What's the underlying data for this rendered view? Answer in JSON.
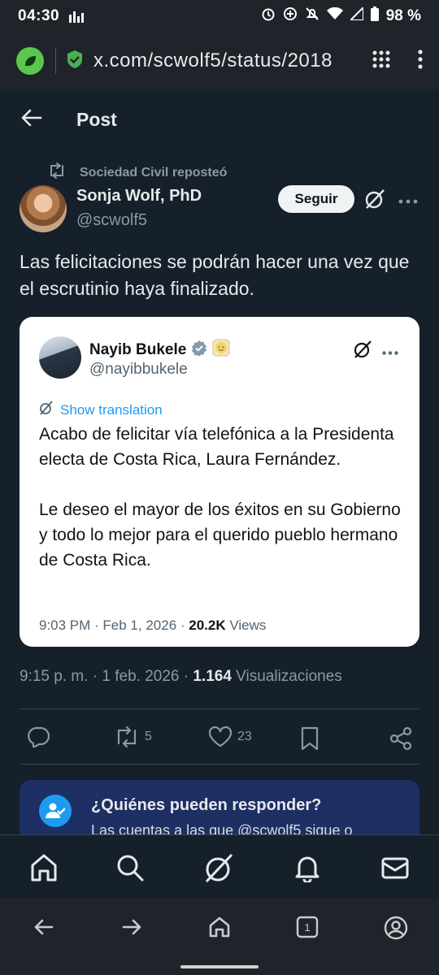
{
  "status_bar": {
    "time": "04:30",
    "battery": "98 %"
  },
  "browser": {
    "url": "x.com/scwolf5/status/2018"
  },
  "header": {
    "title": "Post"
  },
  "post": {
    "repost_label": "Sociedad Civil reposteó",
    "author_name": "Sonja Wolf, PhD",
    "author_handle": "@scwolf5",
    "follow_label": "Seguir",
    "text": "Las felicitaciones se podrán hacer una vez que el escrutinio haya finalizado.",
    "time": "9:15 p. m. · 1 feb. 2026 · ",
    "views_count": "1.164",
    "views_label": " Visualizaciones",
    "reposts": "5",
    "likes": "23"
  },
  "quote": {
    "author_name": "Nayib Bukele",
    "author_handle": "@nayibbukele",
    "translate_label": "Show translation",
    "text": "Acabo de felicitar vía telefónica a la Presidenta electa de Costa Rica, Laura Fernández.\n\nLe deseo el mayor de los éxitos en su Gobierno y todo lo mejor para el querido pueblo hermano de Costa Rica.",
    "time": "9:03 PM · Feb 1, 2026 · ",
    "views_count": "20.2K",
    "views_label": " Views"
  },
  "reply_box": {
    "title": "¿Quiénes pueden responder?",
    "subtitle": "Las cuentas a las que @scwolf5 sigue o"
  },
  "browser_nav": {
    "tabs_count": "1"
  },
  "colors": {
    "background": "#15202b",
    "accent": "#1d9bf0",
    "reply_box": "#1d2f63"
  }
}
